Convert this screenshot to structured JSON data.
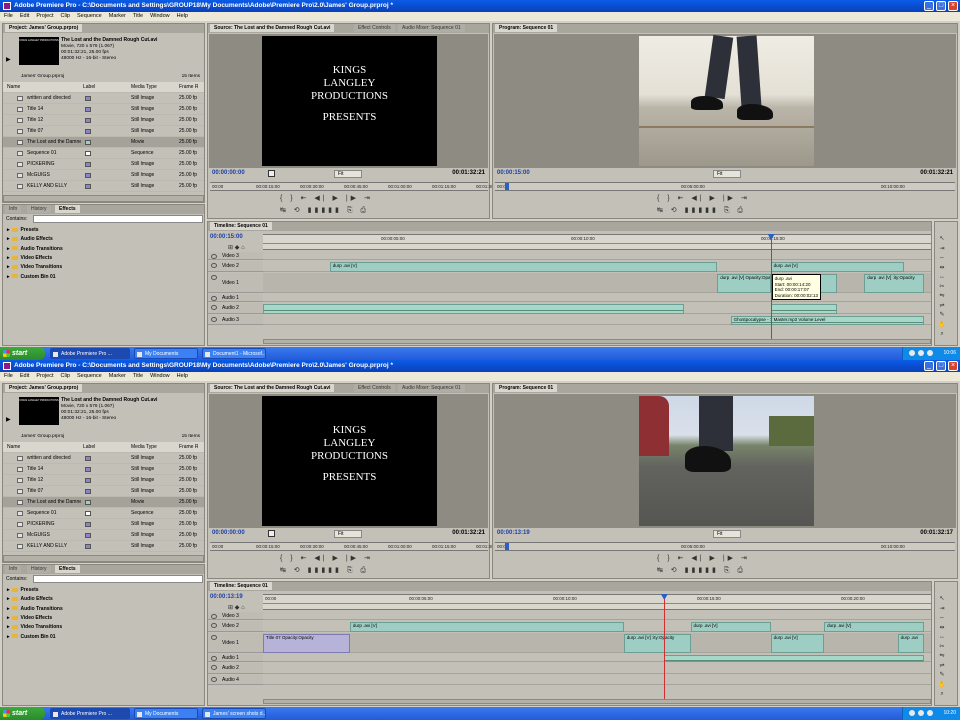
{
  "screens": [
    {
      "title": "Adobe Premiere Pro - C:\\Documents and Settings\\GROUP18\\My Documents\\Adobe\\Premiere Pro\\2.0\\James' Group.prproj *",
      "menu": [
        "File",
        "Edit",
        "Project",
        "Clip",
        "Sequence",
        "Marker",
        "Title",
        "Window",
        "Help"
      ],
      "project": {
        "tab": "Project: James' Group.prproj",
        "clip_name": "The Lost and the Damned Rough Cut.avi",
        "clip_info": [
          "Movie, 720 x 576 (1.067)",
          "00:01:32:21, 25.00 fps",
          "48000 Hz - 16-bit - Stereo"
        ],
        "bin": "James' Group.prproj",
        "count": "15 Items",
        "columns": [
          "Name",
          "Label",
          "Media Type",
          "Frame R"
        ],
        "items": [
          {
            "name": "written and directed",
            "media": "Still Image",
            "rate": "25.00 fp",
            "color": "#8c86c8"
          },
          {
            "name": "Title 14",
            "media": "Still Image",
            "rate": "25.00 fp",
            "color": "#8c86c8"
          },
          {
            "name": "Title 12",
            "media": "Still Image",
            "rate": "25.00 fp",
            "color": "#8c86c8"
          },
          {
            "name": "Title 07",
            "media": "Still Image",
            "rate": "25.00 fp",
            "color": "#8c86c8"
          },
          {
            "name": "The Lost and the Damne",
            "media": "Movie",
            "rate": "25.00 fp",
            "color": "#9dcdc3"
          },
          {
            "name": "Sequence 01",
            "media": "Sequence",
            "rate": "25.00 fp",
            "color": "#ffffff"
          },
          {
            "name": "PICKERING",
            "media": "Still Image",
            "rate": "25.00 fp",
            "color": "#8c86c8"
          },
          {
            "name": "McGUIGS",
            "media": "Still Image",
            "rate": "25.00 fp",
            "color": "#8c86c8"
          },
          {
            "name": "KELLY AND ELLY",
            "media": "Still Image",
            "rate": "25.00 fp",
            "color": "#8c86c8"
          }
        ]
      },
      "effects": {
        "tabs": [
          "Info",
          "History",
          "Effects"
        ],
        "contains_label": "Contains:",
        "folders": [
          "Presets",
          "Audio Effects",
          "Audio Transitions",
          "Video Effects",
          "Video Transitions",
          "Custom Bin 01"
        ]
      },
      "source": {
        "tabs": [
          "Source: The Lost and the Damned Rough Cut.avi",
          "Effect Controls",
          "Audio Mixer: Sequence 01"
        ],
        "card_lines": [
          "KINGS",
          "LANGLEY",
          "PRODUCTIONS",
          "",
          "PRESENTS"
        ],
        "tc_left": "00:00:00:00",
        "fit": "Fit",
        "tc_right": "00:01:32:21",
        "ruler": [
          "00:00",
          "00:00:15:00",
          "00:00:30:00",
          "00:00:45:00",
          "00:01:00:00",
          "00:01:15:00",
          "00:01:30:"
        ]
      },
      "program": {
        "tab": "Program: Sequence 01",
        "tc_left": "00:00:15:00",
        "fit": "Fit",
        "tc_right": "00:01:32:21",
        "ruler": [
          "00:00",
          "00:05:00:00",
          "00:10:00:00"
        ]
      },
      "timeline": {
        "tab": "Timeline: Sequence 01",
        "tc": "00:00:15:00",
        "ruler": [
          "00:00:05:00",
          "00:00:10:00",
          "00:00:15:00"
        ],
        "tracks": [
          "Video 3",
          "Video 2",
          "Video 1",
          "Audio 1",
          "Audio 2",
          "Audio 3"
        ],
        "clips": [
          {
            "track": 1,
            "label": "durp .avi [V]",
            "kind": "v",
            "start": 0.1,
            "end": 0.68
          },
          {
            "track": 1,
            "label": "durp .avi [V]",
            "kind": "v",
            "start": 0.76,
            "end": 0.96
          },
          {
            "track": 2,
            "label": "durp .avi [V] Opacity:Opacity",
            "kind": "v",
            "start": 0.68,
            "end": 0.76
          },
          {
            "track": 2,
            "label": "durp .avi [V] ",
            "kind": "v",
            "start": 0.76,
            "end": 0.86
          },
          {
            "track": 2,
            "label": "durp .avi [V] :ity:Opacity",
            "kind": "v",
            "start": 0.9,
            "end": 0.99
          },
          {
            "track": 4,
            "label": "",
            "kind": "a",
            "start": 0.0,
            "end": 0.63
          },
          {
            "track": 4,
            "label": "",
            "kind": "a",
            "start": 0.76,
            "end": 0.86
          },
          {
            "track": 5,
            "label": "Ghostpocalypse - 7 Master.mp3 Volume:Level",
            "kind": "a",
            "start": 0.7,
            "end": 0.99
          }
        ],
        "tooltip": [
          "durp .avi",
          "Start: 00:00:14:20",
          "End: 00:00:17:07",
          "Duration: 00:00:02:13"
        ],
        "playhead": 0.76
      },
      "taskbar": {
        "start": "start",
        "items": [
          "Adobe Premiere Pro ...",
          "My Documents",
          "Document1 - Microsof..."
        ],
        "clock": "10:06"
      },
      "frame": "walk"
    },
    {
      "title": "Adobe Premiere Pro - C:\\Documents and Settings\\GROUP18\\My Documents\\Adobe\\Premiere Pro\\2.0\\James' Group.prproj *",
      "menu": [
        "File",
        "Edit",
        "Project",
        "Clip",
        "Sequence",
        "Marker",
        "Title",
        "Window",
        "Help"
      ],
      "project": {
        "tab": "Project: James' Group.prproj",
        "clip_name": "The Lost and the Damned Rough Cut.avi",
        "clip_info": [
          "Movie, 720 x 576 (1.067)",
          "00:01:32:21, 25.00 fps",
          "48000 Hz - 16-bit - Stereo"
        ],
        "bin": "James' Group.prproj",
        "count": "15 Items",
        "columns": [
          "Name",
          "Label",
          "Media Type",
          "Frame R"
        ],
        "items": [
          {
            "name": "written and directed",
            "media": "Still Image",
            "rate": "25.00 fp",
            "color": "#8c86c8"
          },
          {
            "name": "Title 14",
            "media": "Still Image",
            "rate": "25.00 fp",
            "color": "#8c86c8"
          },
          {
            "name": "Title 12",
            "media": "Still Image",
            "rate": "25.00 fp",
            "color": "#8c86c8"
          },
          {
            "name": "Title 07",
            "media": "Still Image",
            "rate": "25.00 fp",
            "color": "#8c86c8"
          },
          {
            "name": "The Lost and the Damne",
            "media": "Movie",
            "rate": "25.00 fp",
            "color": "#9dcdc3"
          },
          {
            "name": "Sequence 01",
            "media": "Sequence",
            "rate": "25.00 fp",
            "color": "#ffffff"
          },
          {
            "name": "PICKERING",
            "media": "Still Image",
            "rate": "25.00 fp",
            "color": "#8c86c8"
          },
          {
            "name": "McGUIGS",
            "media": "Still Image",
            "rate": "25.00 fp",
            "color": "#8c86c8"
          },
          {
            "name": "KELLY AND ELLY",
            "media": "Still Image",
            "rate": "25.00 fp",
            "color": "#8c86c8"
          }
        ]
      },
      "effects": {
        "tabs": [
          "Info",
          "History",
          "Effects"
        ],
        "contains_label": "Contains:",
        "folders": [
          "Presets",
          "Audio Effects",
          "Audio Transitions",
          "Video Effects",
          "Video Transitions",
          "Custom Bin 01"
        ]
      },
      "source": {
        "tabs": [
          "Source: The Lost and the Damned Rough Cut.avi",
          "Effect Controls",
          "Audio Mixer: Sequence 01"
        ],
        "card_lines": [
          "KINGS",
          "LANGLEY",
          "PRODUCTIONS",
          "",
          "PRESENTS"
        ],
        "tc_left": "00:00:00:00",
        "fit": "Fit",
        "tc_right": "00:01:32:21",
        "ruler": [
          "00:00",
          "00:00:15:00",
          "00:00:30:00",
          "00:00:45:00",
          "00:01:00:00",
          "00:01:15:00",
          "00:01:30:"
        ]
      },
      "program": {
        "tab": "Program: Sequence 01",
        "tc_left": "00:00:13:19",
        "fit": "Fit",
        "tc_right": "00:01:32:17",
        "ruler": [
          "00:00",
          "00:05:00:00",
          "00:10:00:00"
        ]
      },
      "timeline": {
        "tab": "Timeline: Sequence 01",
        "tc": "00:00:13:19",
        "ruler": [
          "00:00",
          "00:00:05:00",
          "00:00:10:00",
          "00:00:15:00",
          "00:00:20:00"
        ],
        "tracks": [
          "Video 3",
          "Video 2",
          "Video 1",
          "Audio 1",
          "Audio 2",
          "Audio 4"
        ],
        "clips": [
          {
            "track": 1,
            "label": "durp .avi [V]",
            "kind": "v",
            "start": 0.13,
            "end": 0.54
          },
          {
            "track": 1,
            "label": "durp .avi [V]",
            "kind": "v",
            "start": 0.64,
            "end": 0.76
          },
          {
            "track": 1,
            "label": "durp .avi [V]",
            "kind": "v",
            "start": 0.84,
            "end": 0.99
          },
          {
            "track": 2,
            "label": "Title 07 Opacity:Opacity",
            "kind": "t",
            "start": 0.0,
            "end": 0.13
          },
          {
            "track": 2,
            "label": "durp .avi [V] :ity:Opacity",
            "kind": "v",
            "start": 0.54,
            "end": 0.64
          },
          {
            "track": 2,
            "label": "durp .avi [V]",
            "kind": "v",
            "start": 0.76,
            "end": 0.84
          },
          {
            "track": 2,
            "label": "durp .avi",
            "kind": "v",
            "start": 0.95,
            "end": 0.99
          },
          {
            "track": 3,
            "label": "",
            "kind": "a",
            "start": 0.6,
            "end": 0.99
          }
        ],
        "tooltip": [],
        "playhead": 0.6
      },
      "taskbar": {
        "start": "start",
        "items": [
          "Adobe Premiere Pro ...",
          "My Documents",
          "James' screen shots d..."
        ],
        "clock": "10:20"
      },
      "frame": "road"
    }
  ]
}
